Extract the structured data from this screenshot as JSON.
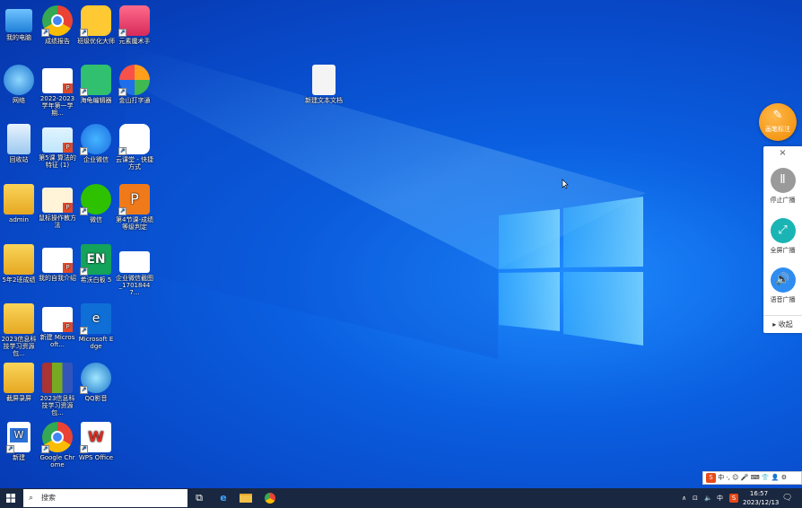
{
  "desktop": {
    "icons": [
      {
        "label": "我的电脑"
      },
      {
        "label": "成绩报告"
      },
      {
        "label": "班级优化大师"
      },
      {
        "label": "元素魔术手"
      },
      {
        "label": "网络"
      },
      {
        "label": "2022-2023学年第一学期..."
      },
      {
        "label": "海龟编辑器"
      },
      {
        "label": "金山打字通"
      },
      {
        "label": "回收站"
      },
      {
        "label": "第5课 算法的特征 (1)"
      },
      {
        "label": "企业微信"
      },
      {
        "label": "云课堂 - 快捷方式"
      },
      {
        "label": "admin"
      },
      {
        "label": "鼠标操作教方法"
      },
      {
        "label": "微信"
      },
      {
        "label": "第4节课-成绩等级判定"
      },
      {
        "label": "5年2班成绩"
      },
      {
        "label": "我的自我介绍"
      },
      {
        "label": "希沃白板 5"
      },
      {
        "label": "企业微信截图_17018447..."
      },
      {
        "label": "2023信息科技学习资源包..."
      },
      {
        "label": "新建 Microsoft..."
      },
      {
        "label": "Microsoft Edge"
      },
      {
        "label": "截屏录屏"
      },
      {
        "label": "2023信息科技学习资源包..."
      },
      {
        "label": "QQ影音"
      },
      {
        "label": "新建"
      },
      {
        "label": "Google Chrome"
      },
      {
        "label": "WPS Office"
      },
      {
        "label": "新建文本文档"
      }
    ]
  },
  "panel": {
    "top_button": "画笔标注",
    "close": "×",
    "items": [
      {
        "label": "停止广播",
        "icon": "pause-icon"
      },
      {
        "label": "全屏广播",
        "icon": "expand-icon"
      },
      {
        "label": "语音广播",
        "icon": "speaker-icon"
      }
    ],
    "collapse": "收起"
  },
  "taskbar": {
    "search_placeholder": "搜索",
    "ime": "中",
    "time": "16:57",
    "date": "2023/12/13",
    "ime_bar": "中 ·, ☺ 🎤 ⌨ 👕 👤 ⚙"
  },
  "colors": {
    "desktop": "#0a5fe0",
    "taskbar": "#1a2740",
    "panel_accent": "#f08a00"
  }
}
